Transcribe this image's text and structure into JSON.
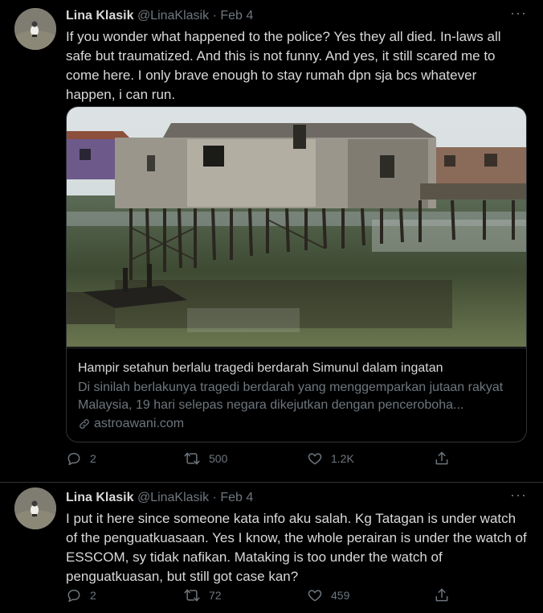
{
  "tweets": [
    {
      "name": "Lina Klasik",
      "handle": "@LinaKlasik",
      "dot": "·",
      "date": "Feb 4",
      "more": "···",
      "text": "If you wonder what happened to the police? Yes they all died. In-laws all safe but traumatized. And this is not funny. And yes, it still scared me to come here. I only brave enough to stay rumah dpn sja bcs whatever happen, i can run.",
      "card": {
        "title": "Hampir setahun berlalu tragedi berdarah Simunul dalam ingatan",
        "description": "Di sinilah berlakunya tragedi berdarah yang menggemparkan jutaan rakyat Malaysia, 19 hari selepas negara dikejutkan dengan penceroboha...",
        "site": "astroawani.com"
      },
      "replies": "2",
      "retweets": "500",
      "likes": "1.2K"
    },
    {
      "name": "Lina Klasik",
      "handle": "@LinaKlasik",
      "dot": "·",
      "date": "Feb 4",
      "more": "···",
      "text": "I put it here since someone kata info aku salah. Kg Tatagan is under watch of the penguatkuasaan. Yes I know, the whole perairan is under the watch of ESSCOM, sy tidak nafikan. Mataking is too under the watch of penguatkuasan, but still got case kan?",
      "replies": "2",
      "retweets": "72",
      "likes": "459"
    }
  ],
  "icons": {
    "reply": "reply-icon",
    "retweet": "retweet-icon",
    "like": "heart-icon",
    "share": "share-icon",
    "link": "link-icon",
    "more": "more-icon"
  },
  "colors": {
    "background": "#000000",
    "text": "#d9d9d9",
    "muted": "#6e767d",
    "border": "#2f3336"
  }
}
